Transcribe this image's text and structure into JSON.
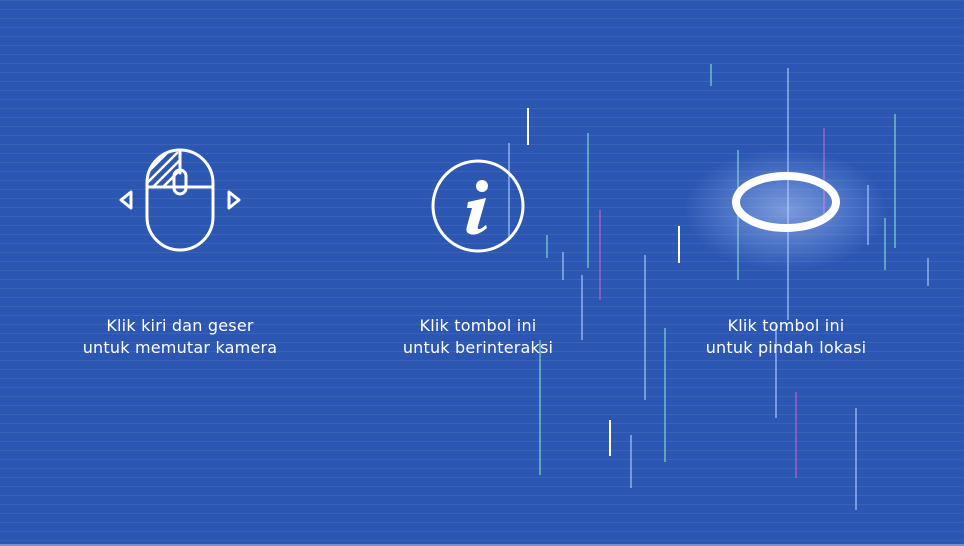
{
  "background_color": "#2b56b2",
  "tiles": [
    {
      "icon": "mouse-drag-icon",
      "line1": "Klik kiri dan geser",
      "line2": "untuk memutar kamera"
    },
    {
      "icon": "info-icon",
      "line1": "Klik tombol ini",
      "line2": "untuk berinteraksi"
    },
    {
      "icon": "teleport-ring-icon",
      "line1": "Klik tombol ini",
      "line2": "untuk pindah lokasi"
    }
  ]
}
